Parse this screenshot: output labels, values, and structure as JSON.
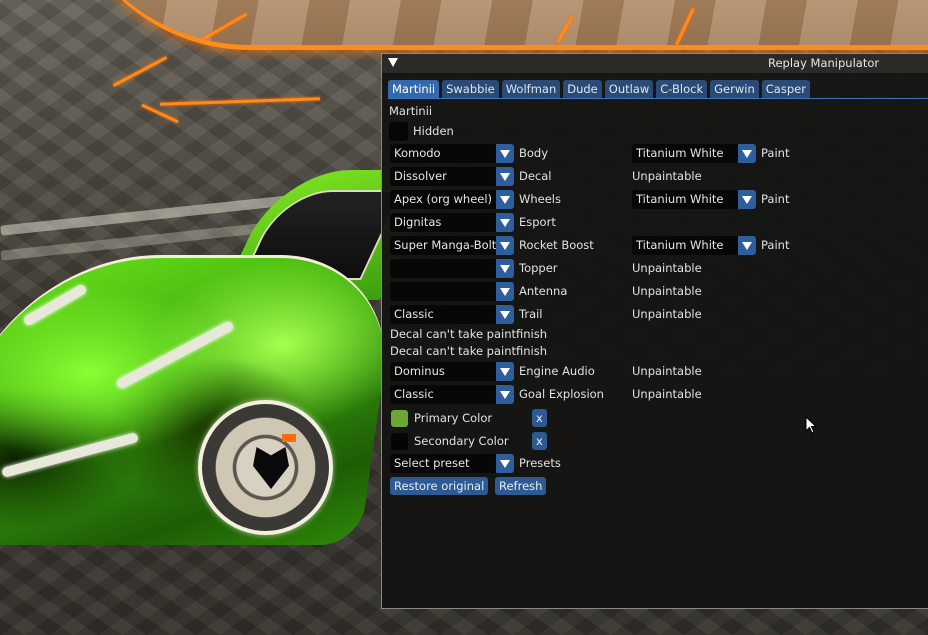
{
  "window": {
    "title": "Replay Manipulator",
    "tabs": [
      {
        "label": "Martinii",
        "active": true
      },
      {
        "label": "Swabbie",
        "active": false
      },
      {
        "label": "Wolfman",
        "active": false
      },
      {
        "label": "Dude",
        "active": false
      },
      {
        "label": "Outlaw",
        "active": false
      },
      {
        "label": "C-Block",
        "active": false
      },
      {
        "label": "Gerwin",
        "active": false
      },
      {
        "label": "Casper",
        "active": false
      }
    ]
  },
  "player": {
    "name": "Martinii",
    "hidden_label": "Hidden",
    "hidden_checked": false
  },
  "items": [
    {
      "value": "Komodo",
      "slot": "Body",
      "paint_value": "Titanium White",
      "paint_label": "Paint",
      "paintable": true
    },
    {
      "value": "Dissolver",
      "slot": "Decal",
      "paint_status": "Unpaintable",
      "paintable": false
    },
    {
      "value": "Apex (org wheel)",
      "slot": "Wheels",
      "paint_value": "Titanium White",
      "paint_label": "Paint",
      "paintable": true
    },
    {
      "value": "Dignitas",
      "slot": "Esport",
      "paintable": null
    },
    {
      "value": "Super Manga-Bolt",
      "slot": "Rocket Boost",
      "paint_value": "Titanium White",
      "paint_label": "Paint",
      "paintable": true
    },
    {
      "value": "",
      "slot": "Topper",
      "paint_status": "Unpaintable",
      "paintable": false
    },
    {
      "value": "",
      "slot": "Antenna",
      "paint_status": "Unpaintable",
      "paintable": false
    },
    {
      "value": "Classic",
      "slot": "Trail",
      "paint_status": "Unpaintable",
      "paintable": false
    }
  ],
  "notices": [
    "Decal can't take paintfinish",
    "Decal can't take paintfinish"
  ],
  "extra_items": [
    {
      "value": "Dominus",
      "slot": "Engine Audio",
      "paint_status": "Unpaintable"
    },
    {
      "value": "Classic",
      "slot": "Goal Explosion",
      "paint_status": "Unpaintable"
    }
  ],
  "colors": {
    "primary": {
      "label": "Primary Color",
      "swatch": "#6aa832",
      "clear_label": "x"
    },
    "secondary": {
      "label": "Secondary Color",
      "swatch": "#050505",
      "clear_label": "x"
    }
  },
  "presets": {
    "value": "Select preset",
    "label": "Presets"
  },
  "buttons": {
    "restore": "Restore original",
    "refresh": "Refresh"
  },
  "theme": {
    "accent": "#3468ad",
    "tab_inactive": "#2a4a77",
    "window_bg": "#141413"
  }
}
